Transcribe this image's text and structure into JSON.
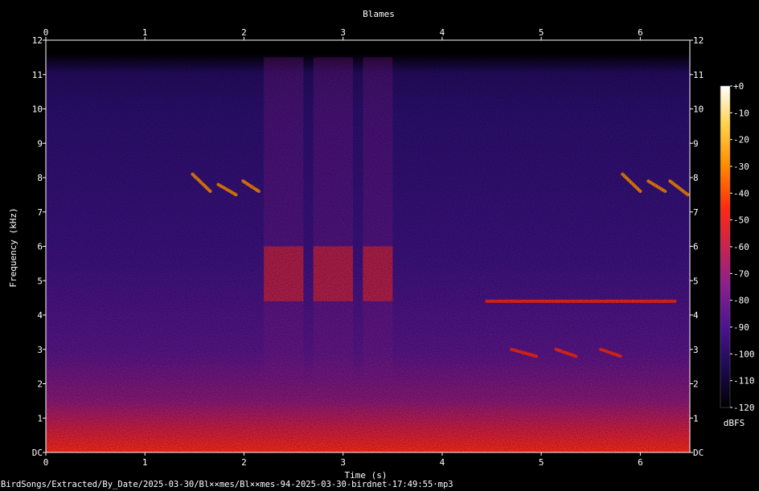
{
  "chart_data": {
    "type": "heatmap",
    "title": "Blames",
    "xlabel": "Time (s)",
    "ylabel": "Frequency (kHz)",
    "xlim": [
      0,
      6.5
    ],
    "ylim": [
      0,
      12
    ],
    "x_ticks": [
      "0",
      "1",
      "2",
      "3",
      "4",
      "5",
      "6"
    ],
    "y_ticks": [
      "DC",
      "1",
      "2",
      "3",
      "4",
      "5",
      "6",
      "7",
      "8",
      "9",
      "10",
      "11",
      "12"
    ],
    "colorbar": {
      "label": "dBFS",
      "range": [
        -120,
        0
      ],
      "ticks": [
        "+0",
        "-10",
        "-20",
        "-30",
        "-40",
        "-50",
        "-60",
        "-70",
        "-80",
        "-90",
        "-100",
        "-110",
        "-120"
      ],
      "colormap": [
        "#000000",
        "#1b0a4e",
        "#4a1490",
        "#8c1f8f",
        "#c8234f",
        "#ff2a10",
        "#ff8a00",
        "#ffd24a",
        "#ffffff"
      ]
    },
    "events": [
      {
        "name": "descending whistle 1",
        "t_start": 1.48,
        "t_end": 1.66,
        "f_start": 8.1,
        "f_end": 7.6,
        "level_db": -30
      },
      {
        "name": "descending whistle 2",
        "t_start": 1.74,
        "t_end": 1.92,
        "f_start": 7.8,
        "f_end": 7.5,
        "level_db": -35
      },
      {
        "name": "descending whistle 3",
        "t_start": 1.99,
        "t_end": 2.15,
        "f_start": 7.9,
        "f_end": 7.6,
        "level_db": -35
      },
      {
        "name": "broadband buzz 1",
        "t_start": 2.2,
        "t_end": 2.6,
        "f_start": 4.4,
        "f_end": 6.0,
        "level_db": -40
      },
      {
        "name": "broadband buzz 2",
        "t_start": 2.7,
        "t_end": 3.1,
        "f_start": 4.4,
        "f_end": 6.0,
        "level_db": -40
      },
      {
        "name": "broadband buzz 3",
        "t_start": 3.2,
        "t_end": 3.5,
        "f_start": 4.4,
        "f_end": 6.0,
        "level_db": -42
      },
      {
        "name": "flat tone",
        "t_start": 4.45,
        "t_end": 6.35,
        "f_start": 4.4,
        "f_end": 4.4,
        "level_db": -45
      },
      {
        "name": "low hook 1",
        "t_start": 4.7,
        "t_end": 4.95,
        "f_start": 3.0,
        "f_end": 2.8,
        "level_db": -45
      },
      {
        "name": "low hook 2",
        "t_start": 5.15,
        "t_end": 5.35,
        "f_start": 3.0,
        "f_end": 2.8,
        "level_db": -45
      },
      {
        "name": "low hook 3",
        "t_start": 5.6,
        "t_end": 5.8,
        "f_start": 3.0,
        "f_end": 2.8,
        "level_db": -45
      },
      {
        "name": "descending whistle 4",
        "t_start": 5.82,
        "t_end": 6.0,
        "f_start": 8.1,
        "f_end": 7.6,
        "level_db": -30
      },
      {
        "name": "descending whistle 5",
        "t_start": 6.08,
        "t_end": 6.25,
        "f_start": 7.9,
        "f_end": 7.6,
        "level_db": -32
      },
      {
        "name": "descending whistle 6",
        "t_start": 6.3,
        "t_end": 6.48,
        "f_start": 7.9,
        "f_end": 7.5,
        "level_db": -32
      }
    ]
  },
  "footer": {
    "file_path": "BirdSongs/Extracted/By_Date/2025-03-30/Bl××mes/Bl××mes-94-2025-03-30-birdnet-17:49:55·mp3"
  }
}
